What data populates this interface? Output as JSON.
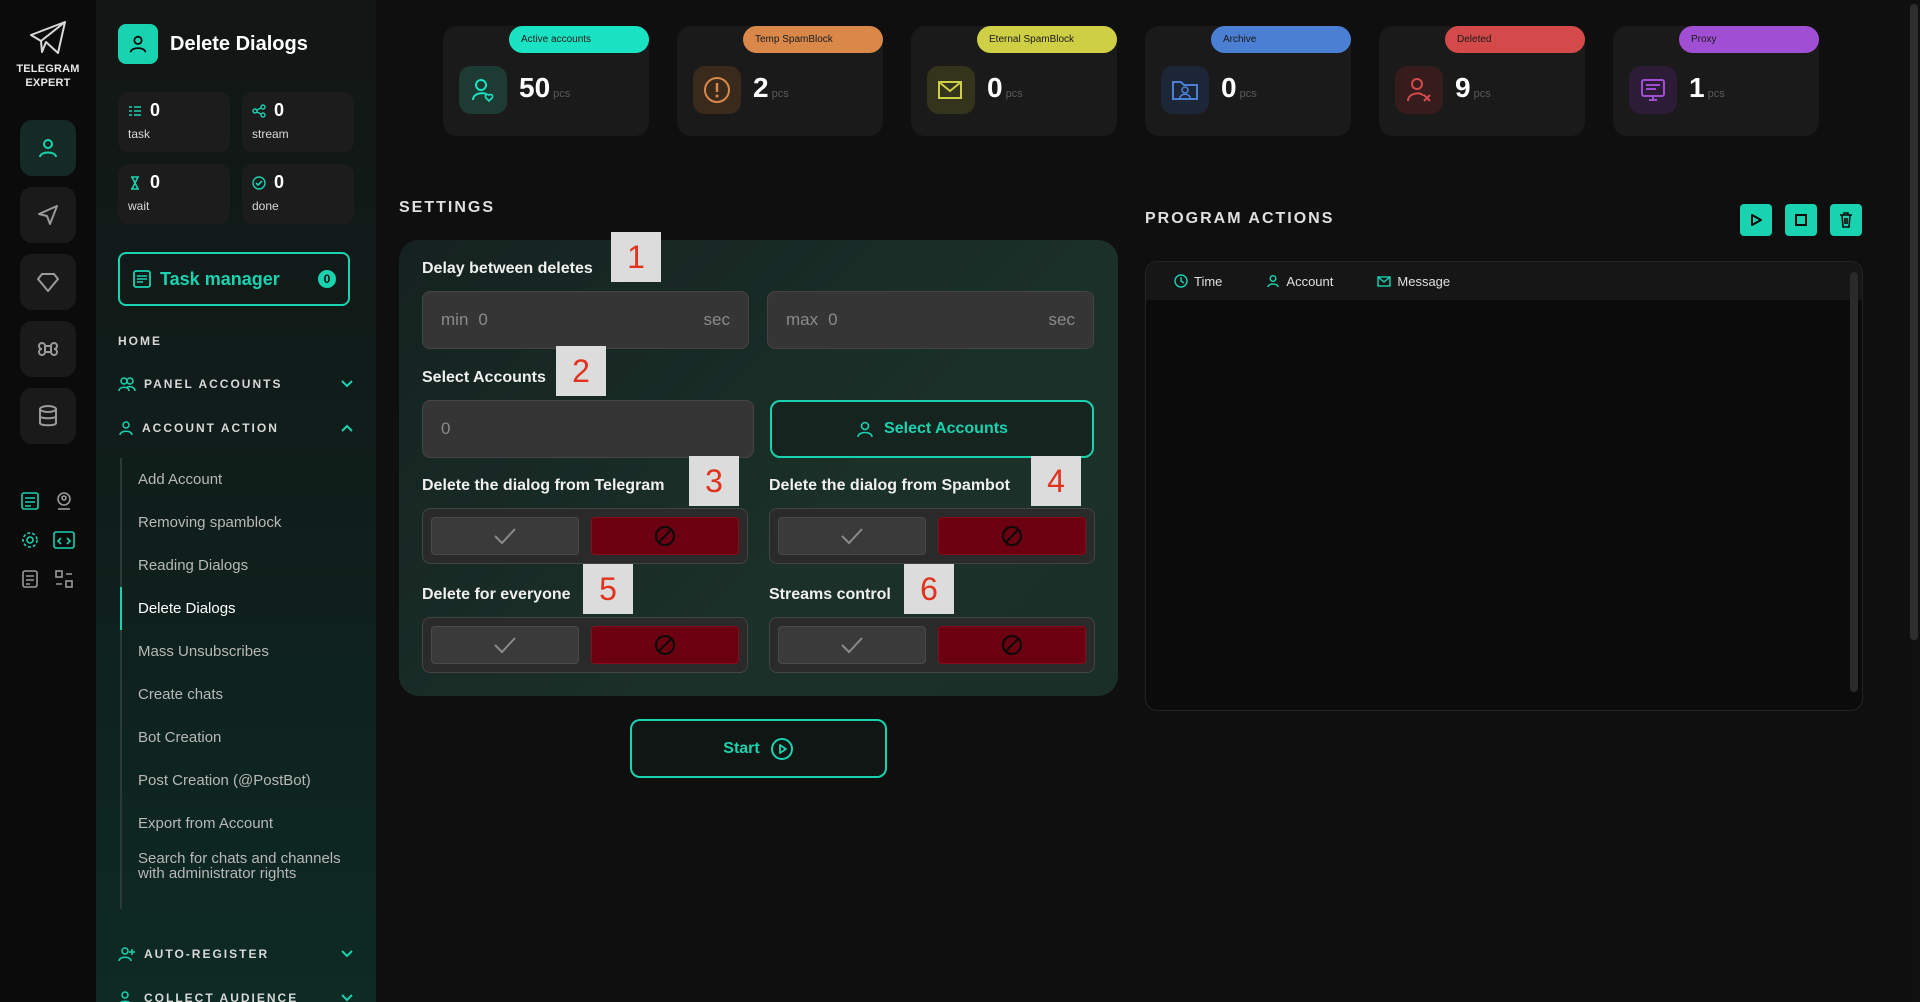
{
  "app": {
    "logo_line1": "TELEGRAM",
    "logo_line2": "EXPERT"
  },
  "sidebar": {
    "title": "Delete Dialogs",
    "stats": [
      {
        "value": "0",
        "label": "task"
      },
      {
        "value": "0",
        "label": "stream"
      },
      {
        "value": "0",
        "label": "wait"
      },
      {
        "value": "0",
        "label": "done"
      }
    ],
    "task_manager": {
      "label": "Task manager",
      "count": "0"
    },
    "home": "HOME",
    "sections": {
      "panel_accounts": "PANEL ACCOUNTS",
      "account_action": "ACCOUNT ACTION",
      "auto_register": "AUTO-REGISTER",
      "collect_audience": "COLLECT AUDIENCE"
    },
    "items": [
      "Add Account",
      "Removing spamblock",
      "Reading Dialogs",
      "Delete Dialogs",
      "Mass Unsubscribes",
      "Create chats",
      "Bot Creation",
      "Post Creation (@PostBot)",
      "Export from Account",
      "Search for chats and channels with administrator rights"
    ]
  },
  "cards": [
    {
      "label": "Active accounts",
      "value": "50",
      "unit": "pcs",
      "color": "#19e3c3"
    },
    {
      "label": "Temp SpamBlock",
      "value": "2",
      "unit": "pcs",
      "color": "#d9884a"
    },
    {
      "label": "Eternal SpamBlock",
      "value": "0",
      "unit": "pcs",
      "color": "#cfcf45"
    },
    {
      "label": "Archive",
      "value": "0",
      "unit": "pcs",
      "color": "#4a7fd4"
    },
    {
      "label": "Deleted",
      "value": "9",
      "unit": "pcs",
      "color": "#d44a4a"
    },
    {
      "label": "Proxy",
      "value": "1",
      "unit": "pcs",
      "color": "#a04fd4"
    }
  ],
  "settings": {
    "title": "SETTINGS",
    "delay_label": "Delay between deletes",
    "min_prefix": "min",
    "min_value": "0",
    "max_prefix": "max",
    "max_value": "0",
    "unit": "sec",
    "select_label": "Select Accounts",
    "select_value": "0",
    "select_button": "Select Accounts",
    "opt_telegram": "Delete the dialog from Telegram",
    "opt_spambot": "Delete the dialog from Spambot",
    "opt_everyone": "Delete for everyone",
    "opt_streams": "Streams control",
    "badges": [
      "1",
      "2",
      "3",
      "4",
      "5",
      "6"
    ],
    "start": "Start"
  },
  "actions": {
    "title": "PROGRAM ACTIONS",
    "columns": [
      "Time",
      "Account",
      "Message"
    ]
  },
  "colors": {
    "accent": "#19d3b0",
    "danger": "#6a0010"
  }
}
